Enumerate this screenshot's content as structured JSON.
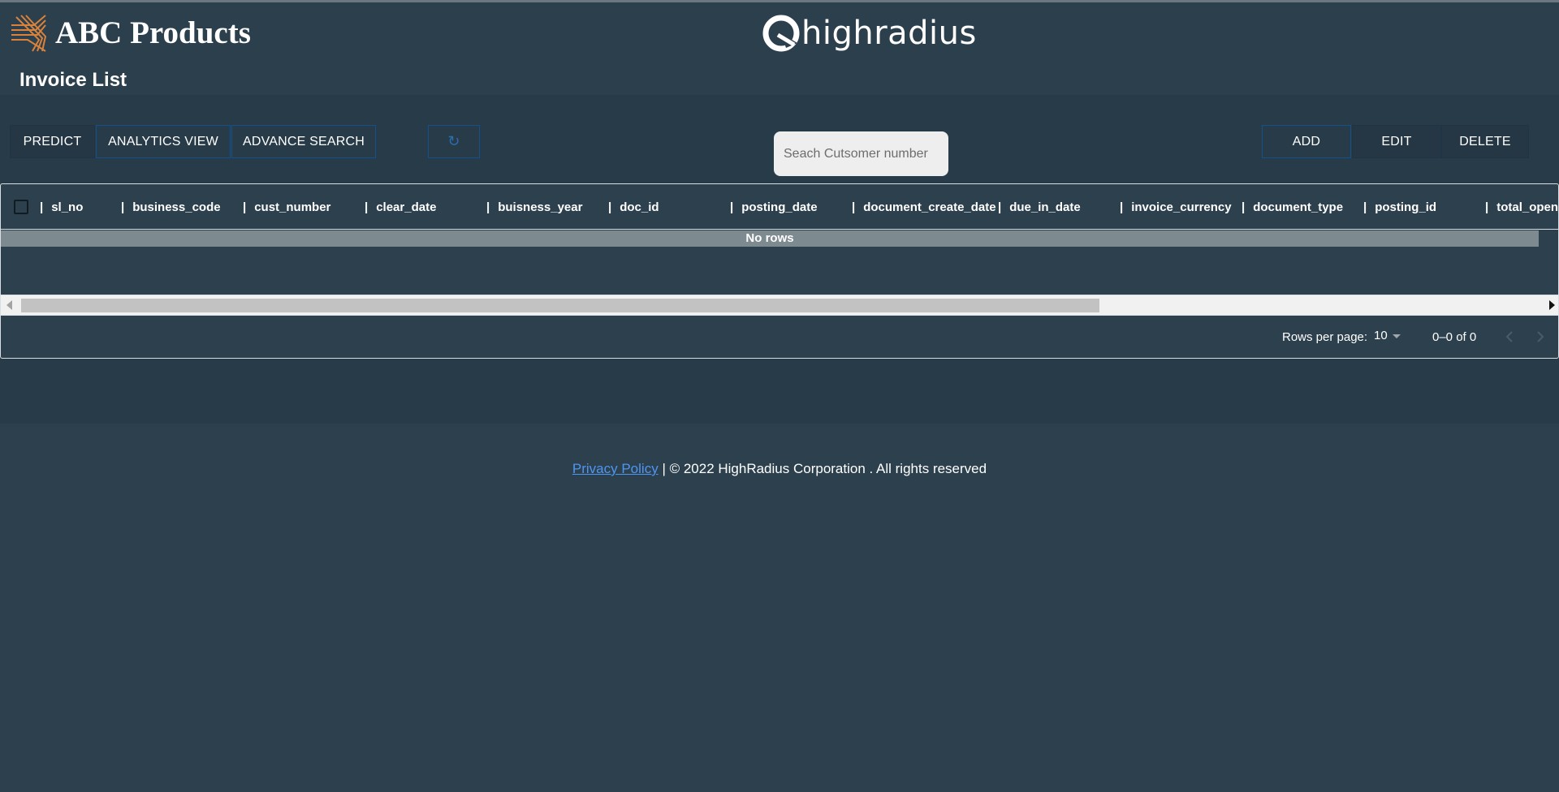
{
  "header": {
    "brand_name": "ABC Products",
    "partner_logo_text": "highradius",
    "page_title": "Invoice List"
  },
  "toolbar": {
    "predict_label": "PREDICT",
    "analytics_label": "ANALYTICS VIEW",
    "advance_search_label": "ADVANCE SEARCH",
    "refresh_glyph": "↻",
    "add_label": "ADD",
    "edit_label": "EDIT",
    "delete_label": "DELETE"
  },
  "search": {
    "placeholder": "Seach Cutsomer number",
    "value": ""
  },
  "grid": {
    "columns": [
      "sl_no",
      "business_code",
      "cust_number",
      "clear_date",
      "buisness_year",
      "doc_id",
      "posting_date",
      "document_create_date",
      "due_in_date",
      "invoice_currency",
      "document_type",
      "posting_id",
      "total_open_amount"
    ],
    "empty_text": "No rows",
    "rows_per_page_label": "Rows per page:",
    "rows_per_page_value": "10",
    "range_text": "0–0 of 0"
  },
  "footer": {
    "privacy_link": "Privacy Policy",
    "copyright": "| © 2022 HighRadius Corporation . All rights reserved"
  },
  "colors": {
    "background": "#2c404e",
    "brand_orange": "#d9823b",
    "link": "#4f96f0",
    "button_border": "#14518a"
  }
}
